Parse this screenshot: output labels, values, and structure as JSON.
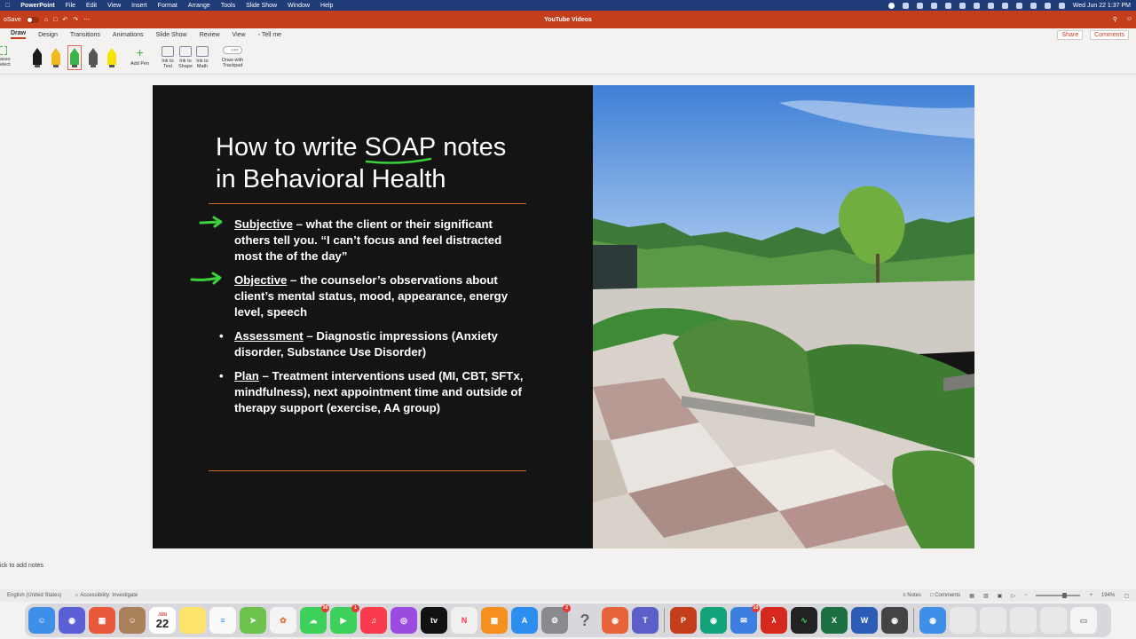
{
  "menubar": {
    "app_name": "PowerPoint",
    "items": [
      "File",
      "Edit",
      "View",
      "Insert",
      "Format",
      "Arrange",
      "Tools",
      "Slide Show",
      "Window",
      "Help"
    ],
    "datetime": "Wed Jun 22  1:37 PM"
  },
  "titlebar": {
    "autosave_label": "oSave",
    "autosave_state": "OFF",
    "document_title": "YouTube Videos"
  },
  "ribbon": {
    "tabs": [
      "Draw",
      "Design",
      "Transitions",
      "Animations",
      "Slide Show",
      "Review",
      "View",
      "Tell me"
    ],
    "active_tab": "Draw",
    "share_label": "Share",
    "comments_label": "Comments",
    "lasso_label_1": "asso",
    "lasso_label_2": "elect",
    "add_pen": "Add Pen",
    "ink_to_text_1": "Ink to",
    "ink_to_text_2": "Text",
    "ink_to_shape_1": "Ink to",
    "ink_to_shape_2": "Shape",
    "ink_to_math_1": "Ink to",
    "ink_to_math_2": "Math",
    "draw_trackpad_toggle": "OFF",
    "draw_trackpad_1": "Draw with",
    "draw_trackpad_2": "Trackpad",
    "pens": [
      {
        "name": "black-pen",
        "color": "#1a1a1a"
      },
      {
        "name": "yellow-pen",
        "color": "#f2b81e"
      },
      {
        "name": "green-pen",
        "color": "#39b54a"
      },
      {
        "name": "gray-pen",
        "color": "#555555"
      },
      {
        "name": "highlighter",
        "color": "#f5e400"
      }
    ]
  },
  "slide": {
    "title_line1_pre": "How to write ",
    "title_soap": "SOAP",
    "title_line1_post": " notes",
    "title_line2": "in Behavioral Health",
    "accent_rule_color": "#c66a2e",
    "ink_color": "#39d23a",
    "bullets": [
      {
        "term": "Subjective",
        "text": " – what the client or their significant others tell you. “I can’t focus and feel distracted most the of the day”",
        "marker": "arrow"
      },
      {
        "term": "Objective",
        "text": " – the counselor’s observations about client’s mental status, mood, appearance, energy level, speech",
        "marker": "arrow"
      },
      {
        "term": "Assessment",
        "text": " – Diagnostic impressions (Anxiety disorder, Substance Use Disorder)",
        "marker": "•"
      },
      {
        "term": "Plan",
        "text": " – Treatment interventions used (MI, CBT, SFTx, mindfulness), next appointment time and outside of therapy support (exercise, AA group)",
        "marker": "•"
      }
    ]
  },
  "notes": {
    "placeholder": "ick to add notes"
  },
  "statusbar": {
    "language": "English (United States)",
    "accessibility": "Accessibility: Investigate",
    "notes_label": "Notes",
    "comments_label": "Comments",
    "zoom": "194%"
  },
  "dock": {
    "calendar_month": "JUN",
    "calendar_day": "22",
    "messages_badge": "36",
    "facetime_badge": "1",
    "settings_badge": "2",
    "mail_badge": "10"
  }
}
